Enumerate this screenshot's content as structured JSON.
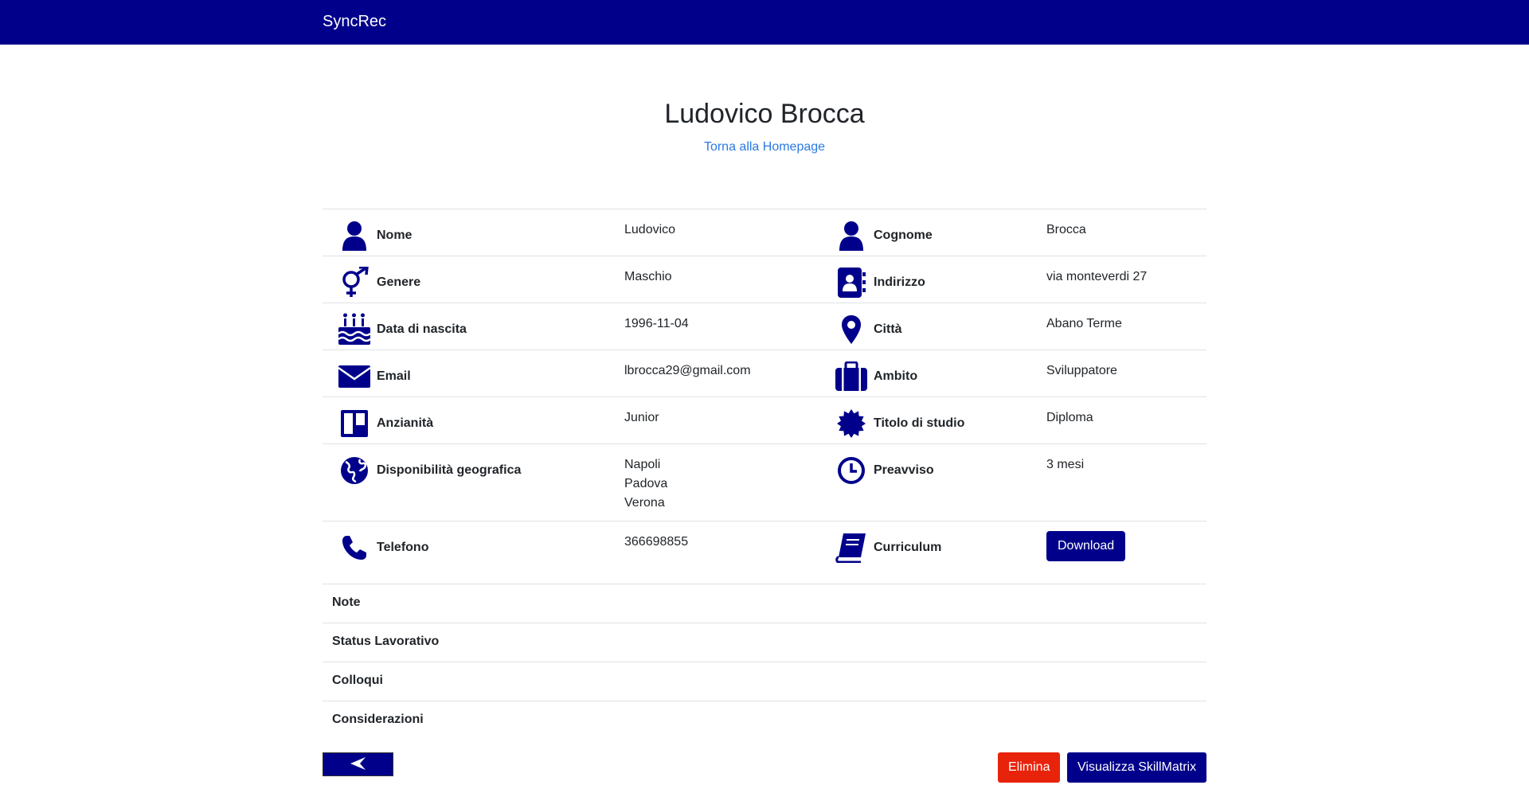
{
  "navbar": {
    "brand": "SyncRec"
  },
  "header": {
    "title": "Ludovico Brocca",
    "home_link": "Torna alla Homepage"
  },
  "details": {
    "rows": [
      {
        "left": {
          "icon": "user-icon",
          "label": "Nome",
          "value": "Ludovico"
        },
        "right": {
          "icon": "user-icon",
          "label": "Cognome",
          "value": "Brocca"
        }
      },
      {
        "left": {
          "icon": "gender-icon",
          "label": "Genere",
          "value": "Maschio"
        },
        "right": {
          "icon": "address-book-icon",
          "label": "Indirizzo",
          "value": "via monteverdi 27"
        }
      },
      {
        "left": {
          "icon": "birthday-cake-icon",
          "label": "Data di nascita",
          "value": "1996-11-04"
        },
        "right": {
          "icon": "map-marker-icon",
          "label": "Città",
          "value": "Abano Terme"
        }
      },
      {
        "left": {
          "icon": "envelope-icon",
          "label": "Email",
          "value": "lbrocca29@gmail.com"
        },
        "right": {
          "icon": "briefcase-icon",
          "label": "Ambito",
          "value": "Sviluppatore"
        }
      },
      {
        "left": {
          "icon": "trello-icon",
          "label": "Anzianità",
          "value": "Junior"
        },
        "right": {
          "icon": "certificate-icon",
          "label": "Titolo di studio",
          "value": "Diploma"
        }
      },
      {
        "left": {
          "icon": "globe-icon",
          "label": "Disponibilità geografica",
          "values": [
            "Napoli",
            "Padova",
            "Verona"
          ]
        },
        "right": {
          "icon": "clock-icon",
          "label": "Preavviso",
          "value": "3 mesi"
        }
      },
      {
        "left": {
          "icon": "phone-icon",
          "label": "Telefono",
          "value": "366698855"
        },
        "right": {
          "icon": "book-icon",
          "label": "Curriculum",
          "button": "Download"
        }
      }
    ]
  },
  "sections": [
    "Note",
    "Status Lavorativo",
    "Colloqui",
    "Considerazioni"
  ],
  "actions": {
    "delete_label": "Elimina",
    "skillmatrix_label": "Visualizza SkillMatrix",
    "back_icon": "arrow-left-icon"
  },
  "colors": {
    "navbar": "#00008b",
    "primary": "#00008b",
    "danger": "#e8230b",
    "link": "#2a7ae2"
  }
}
